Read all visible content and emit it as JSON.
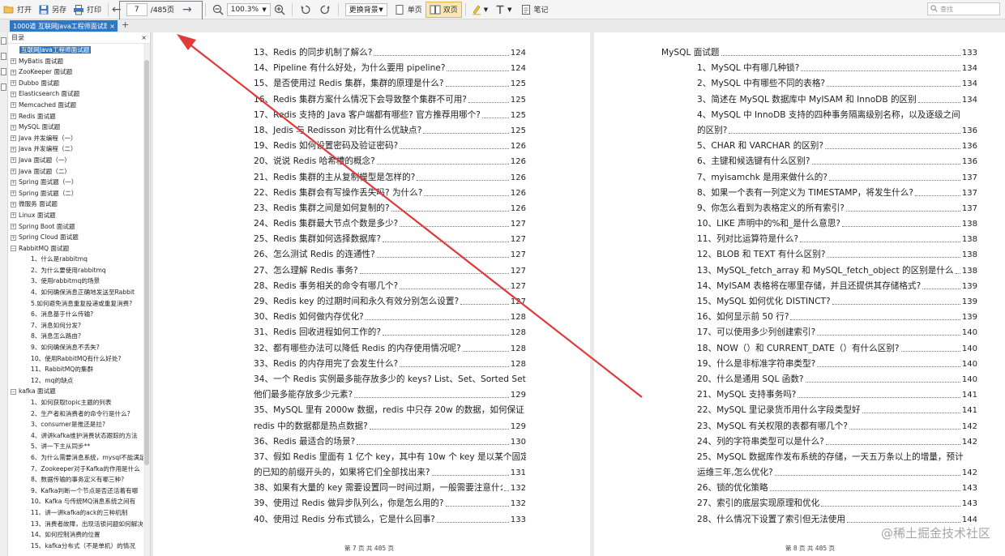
{
  "toolbar": {
    "open": "打开",
    "save_as": "另存",
    "print": "打印",
    "page_current": "7",
    "page_total": "/485页",
    "zoom": "100.3%",
    "bg": "更换背景",
    "single": "单页",
    "double": "双页",
    "note": "笔记",
    "search_placeholder": "查找"
  },
  "tab": {
    "title": "1000道 互联网Java工程师面试题",
    "close": "×",
    "add": "+"
  },
  "sidebar": {
    "header": "目录",
    "close": "×",
    "items": [
      {
        "label": "互联网Java工程师面试题",
        "level": 0,
        "exp": "",
        "active": true
      },
      {
        "label": "MyBatis 面试题",
        "level": 0,
        "exp": "+"
      },
      {
        "label": "ZooKeeper 面试题",
        "level": 0,
        "exp": "+"
      },
      {
        "label": "Dubbo 面试题",
        "level": 0,
        "exp": "+"
      },
      {
        "label": "Elasticsearch 面试题",
        "level": 0,
        "exp": "+"
      },
      {
        "label": "Memcached 面试题",
        "level": 0,
        "exp": "+"
      },
      {
        "label": "Redis 面试题",
        "level": 0,
        "exp": "+"
      },
      {
        "label": "MySQL 面试题",
        "level": 0,
        "exp": "+"
      },
      {
        "label": "Java 并发编程（一）",
        "level": 0,
        "exp": "+"
      },
      {
        "label": "Java 并发编程（二）",
        "level": 0,
        "exp": "+"
      },
      {
        "label": "Java 面试题（一）",
        "level": 0,
        "exp": "+"
      },
      {
        "label": "Java 面试题（二）",
        "level": 0,
        "exp": "+"
      },
      {
        "label": "Spring 面试题（一）",
        "level": 0,
        "exp": "+"
      },
      {
        "label": "Spring 面试题（二）",
        "level": 0,
        "exp": "+"
      },
      {
        "label": "微服务 面试题",
        "level": 0,
        "exp": "+"
      },
      {
        "label": "Linux 面试题",
        "level": 0,
        "exp": "+"
      },
      {
        "label": "Spring Boot 面试题",
        "level": 0,
        "exp": "+"
      },
      {
        "label": "Spring Cloud 面试题",
        "level": 0,
        "exp": "+"
      },
      {
        "label": "RabbitMQ 面试题",
        "level": 0,
        "exp": "−"
      },
      {
        "label": "1、什么是rabbitmq",
        "level": 1
      },
      {
        "label": "2、为什么要使用rabbitmq",
        "level": 1
      },
      {
        "label": "3、使用rabbitmq的场景",
        "level": 1
      },
      {
        "label": "4、如何确保消息正确地发送至Rabbit",
        "level": 1
      },
      {
        "label": "5.如何避免消息重复投递或重复消费?",
        "level": 1
      },
      {
        "label": "6、消息基于什么传输?",
        "level": 1
      },
      {
        "label": "7、消息如何分发?",
        "level": 1
      },
      {
        "label": "8、消息怎么路由?",
        "level": 1
      },
      {
        "label": "9、如何确保消息不丢失?",
        "level": 1
      },
      {
        "label": "10、使用RabbitMQ有什么好处?",
        "level": 1
      },
      {
        "label": "11、RabbitMQ的集群",
        "level": 1
      },
      {
        "label": "12、mq的缺点",
        "level": 1
      },
      {
        "label": "kafka 面试题",
        "level": 0,
        "exp": "−"
      },
      {
        "label": "1、如何获取topic主题的列表",
        "level": 1
      },
      {
        "label": "2、生产者和消费者的命令行是什么?",
        "level": 1
      },
      {
        "label": "3、consumer是推还是拉?",
        "level": 1
      },
      {
        "label": "4、讲讲kafka维护消费状态跟踪的方法",
        "level": 1
      },
      {
        "label": "5、讲一下主从同步**",
        "level": 1
      },
      {
        "label": "6、为什么需要消息系统，mysql不能满足",
        "level": 1
      },
      {
        "label": "7、Zookeeper对于Kafka的作用是什么",
        "level": 1
      },
      {
        "label": "8、数据传输的事务定义有哪三种?",
        "level": 1
      },
      {
        "label": "9、Kafka判断一个节点是否还活着有哪",
        "level": 1
      },
      {
        "label": "10、Kafka 与传统MQ消息系统之间有",
        "level": 1
      },
      {
        "label": "11、讲一讲kafka的ack的三种机制",
        "level": 1
      },
      {
        "label": "13、消费者故障，出现活锁问题如何解决",
        "level": 1
      },
      {
        "label": "14、如何控制消费的位置",
        "level": 1
      },
      {
        "label": "15、kafka分布式（不是单机）的情况",
        "level": 1
      }
    ]
  },
  "left_page": {
    "footer": "第 7 页 共 485 页",
    "rows": [
      {
        "t": "13、Redis 的同步机制了解么?",
        "p": "124"
      },
      {
        "t": "14、Pipeline 有什么好处，为什么要用 pipeline?",
        "p": "124"
      },
      {
        "t": "15、是否使用过 Redis 集群，集群的原理是什么?",
        "p": "125"
      },
      {
        "t": "16、Redis 集群方案什么情况下会导致整个集群不可用?",
        "p": "125"
      },
      {
        "t": "17、Redis 支持的 Java 客户端都有哪些? 官方推荐用哪个?",
        "p": "125"
      },
      {
        "t": "18、Jedis 与 Redisson 对比有什么优缺点?",
        "p": "125"
      },
      {
        "t": "19、Redis 如何设置密码及验证密码?",
        "p": "126"
      },
      {
        "t": "20、说说 Redis 哈希槽的概念?",
        "p": "126"
      },
      {
        "t": "21、Redis 集群的主从复制模型是怎样的?",
        "p": "126"
      },
      {
        "t": "22、Redis 集群会有写操作丢失吗? 为什么?",
        "p": "126"
      },
      {
        "t": "23、Redis 集群之间是如何复制的?",
        "p": "126"
      },
      {
        "t": "24、Redis 集群最大节点个数是多少?",
        "p": "127"
      },
      {
        "t": "25、Redis 集群如何选择数据库?",
        "p": "127"
      },
      {
        "t": "26、怎么测试 Redis 的连通性?",
        "p": "127"
      },
      {
        "t": "27、怎么理解 Redis 事务?",
        "p": "127"
      },
      {
        "t": "28、Redis 事务相关的命令有哪几个?",
        "p": "127"
      },
      {
        "t": "29、Redis key 的过期时间和永久有效分别怎么设置?",
        "p": "127"
      },
      {
        "t": "30、Redis 如何做内存优化?",
        "p": "128"
      },
      {
        "t": "31、Redis 回收进程如何工作的?",
        "p": "128"
      },
      {
        "t": "32、都有哪些办法可以降低 Redis 的内存使用情况呢?",
        "p": "128"
      },
      {
        "t": "33、Redis 的内存用完了会发生什么?",
        "p": "128"
      },
      {
        "t": "34、一个 Redis 实例最多能存放多少的 keys? List、Set、Sorted Set",
        "p": "",
        "nodots": true
      },
      {
        "t": "他们最多能存放多少元素?",
        "p": "129"
      },
      {
        "t": "35、MySQL 里有 2000w 数据，redis 中只存 20w 的数据，如何保证",
        "p": "",
        "nodots": true
      },
      {
        "t": "redis 中的数据都是热点数据?",
        "p": "129"
      },
      {
        "t": "36、Redis 最适合的场景?",
        "p": "130"
      },
      {
        "t": "37、假如 Redis 里面有 1 亿个 key，其中有 10w 个 key 是以某个固定",
        "p": "",
        "nodots": true
      },
      {
        "t": "的已知的前缀开头的，如果将它们全部找出来?",
        "p": "131"
      },
      {
        "t": "38、如果有大量的 key 需要设置同一时间过期，一般需要注意什么?",
        "p": "132"
      },
      {
        "t": "39、使用过 Redis 做异步队列么，你是怎么用的?",
        "p": "132"
      },
      {
        "t": "40、使用过 Redis 分布式锁么，它是什么回事?",
        "p": "133"
      }
    ]
  },
  "right_page": {
    "footer": "第 8 页 共 485 页",
    "heading": {
      "t": "MySQL 面试题",
      "p": "133"
    },
    "rows": [
      {
        "t": "1、MySQL 中有哪几种锁?",
        "p": "134"
      },
      {
        "t": "2、MySQL 中有哪些不同的表格?",
        "p": "134"
      },
      {
        "t": "3、简述在 MySQL 数据库中 MyISAM 和 InnoDB 的区别",
        "p": "134"
      },
      {
        "t": "4、MySQL 中 InnoDB 支持的四种事务隔离级别名称，以及逐级之间",
        "p": "",
        "nodots": true
      },
      {
        "t": "的区别?",
        "p": "136"
      },
      {
        "t": "5、CHAR 和 VARCHAR 的区别?",
        "p": "136"
      },
      {
        "t": "6、主键和候选键有什么区别?",
        "p": "136"
      },
      {
        "t": "7、myisamchk 是用来做什么的?",
        "p": "137"
      },
      {
        "t": "8、如果一个表有一列定义为 TIMESTAMP，将发生什么?",
        "p": "137"
      },
      {
        "t": "9、你怎么看到为表格定义的所有索引?",
        "p": "137"
      },
      {
        "t": "10、LIKE 声明中的%和_是什么意思?",
        "p": "138"
      },
      {
        "t": "11、列对比运算符是什么?",
        "p": "138"
      },
      {
        "t": "12、BLOB 和 TEXT 有什么区别?",
        "p": "138"
      },
      {
        "t": "13、MySQL_fetch_array 和 MySQL_fetch_object 的区别是什么?",
        "p": "138"
      },
      {
        "t": "14、MyISAM 表格将在哪里存储，并且还提供其存储格式?",
        "p": "139"
      },
      {
        "t": "15、MySQL 如何优化 DISTINCT?",
        "p": "139"
      },
      {
        "t": "16、如何显示前 50 行?",
        "p": "139"
      },
      {
        "t": "17、可以使用多少列创建索引?",
        "p": "140"
      },
      {
        "t": "18、NOW（）和 CURRENT_DATE（）有什么区别?",
        "p": "140"
      },
      {
        "t": "19、什么是非标准字符串类型?",
        "p": "140"
      },
      {
        "t": "20、什么是通用 SQL 函数?",
        "p": "140"
      },
      {
        "t": "21、MySQL 支持事务吗?",
        "p": "141"
      },
      {
        "t": "22、MySQL 里记录货币用什么字段类型好",
        "p": "141"
      },
      {
        "t": "23、MySQL 有关权限的表都有哪几个?",
        "p": "142"
      },
      {
        "t": "24、列的字符串类型可以是什么?",
        "p": "142"
      },
      {
        "t": "25、MySQL 数据库作发布系统的存储，一天五万条以上的增量，预计",
        "p": "",
        "nodots": true
      },
      {
        "t": "运维三年,怎么优化?",
        "p": "142"
      },
      {
        "t": "26、锁的优化策略",
        "p": "143"
      },
      {
        "t": "27、索引的底层实现原理和优化",
        "p": "143"
      },
      {
        "t": "28、什么情况下设置了索引但无法使用",
        "p": "144"
      }
    ]
  },
  "watermark": "@稀土掘金技术社区",
  "colors": {
    "accent": "#2d77c5",
    "annotation": "#e03a3a"
  }
}
